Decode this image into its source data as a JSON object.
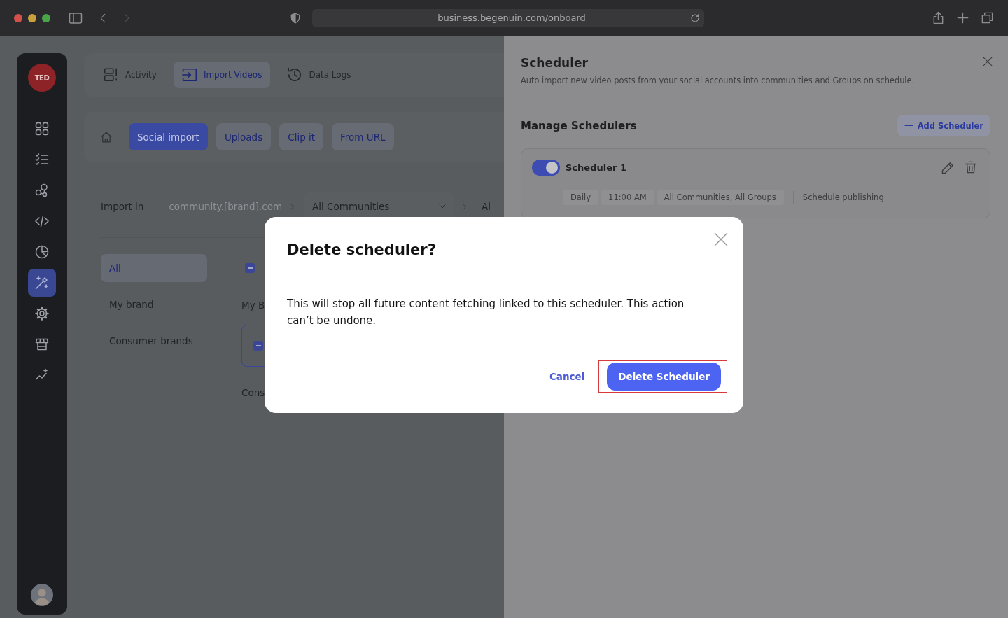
{
  "browser": {
    "url": "business.begenuin.com/onboard"
  },
  "sidebar": {
    "logo": "TED",
    "items": [
      {
        "kind": "grid",
        "selected": false
      },
      {
        "kind": "checklist",
        "selected": false
      },
      {
        "kind": "nodes",
        "selected": false
      },
      {
        "kind": "code",
        "selected": false
      },
      {
        "kind": "pie",
        "selected": false
      },
      {
        "kind": "wand",
        "selected": true
      },
      {
        "kind": "settings",
        "selected": false
      },
      {
        "kind": "store",
        "selected": false
      },
      {
        "kind": "trend",
        "selected": false
      }
    ]
  },
  "top_tabs": [
    {
      "kind": "activity",
      "label": "Activity",
      "selected": false
    },
    {
      "kind": "import",
      "label": "Import Videos",
      "selected": true
    },
    {
      "kind": "logs",
      "label": "Data Logs",
      "selected": false
    }
  ],
  "source_tabs": [
    {
      "label": "Social import",
      "selected": true
    },
    {
      "label": "Uploads",
      "selected": false
    },
    {
      "label": "Clip it",
      "selected": false
    },
    {
      "label": "From URL",
      "selected": false
    }
  ],
  "import_in": {
    "label": "Import in",
    "domain": "community.[brand].com",
    "community_dropdown": "All Communities",
    "group_dropdown": "Al"
  },
  "brand_filters": [
    {
      "label": "All",
      "selected": true
    },
    {
      "label": "My brand",
      "selected": false
    },
    {
      "label": "Consumer brands",
      "selected": false
    }
  ],
  "brand_list": {
    "select_all": {
      "mixed": true
    },
    "groups": [
      {
        "heading": "My B",
        "card_checkbox": {
          "mixed": true
        }
      },
      {
        "heading": "Cons"
      }
    ]
  },
  "scheduler_panel": {
    "title": "Scheduler",
    "subtitle": "Auto import new video posts from your social accounts into communities and Groups on schedule.",
    "section_title": "Manage Schedulers",
    "add_button": "Add Scheduler",
    "schedulers": [
      {
        "name": "Scheduler 1",
        "on": true,
        "tags": [
          "Daily",
          "11:00 AM",
          "All Communities, All Groups"
        ],
        "publishing": "Schedule publishing"
      }
    ]
  },
  "dialog": {
    "title": "Delete scheduler?",
    "message": "This will stop all future content fetching linked to this scheduler. This action can’t be undone.",
    "cancel": "Cancel",
    "confirm": {
      "label": "Delete Scheduler",
      "highlighted": true
    }
  }
}
